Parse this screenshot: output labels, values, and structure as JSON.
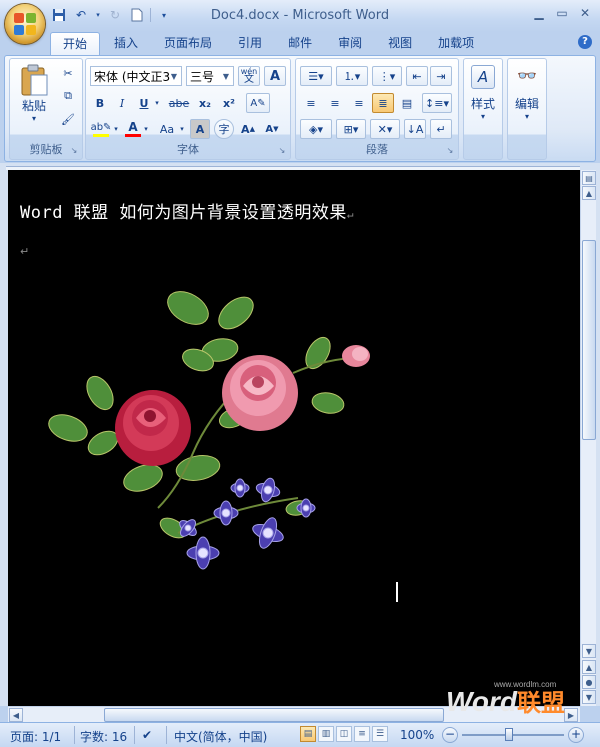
{
  "window": {
    "title": "Doc4.docx - Microsoft Word"
  },
  "ribbon_tabs": [
    "开始",
    "插入",
    "页面布局",
    "引用",
    "邮件",
    "审阅",
    "视图",
    "加载项"
  ],
  "ribbon": {
    "clipboard": {
      "label": "剪贴板",
      "paste": "粘贴"
    },
    "font": {
      "label": "字体",
      "font_name": "宋体 (中文正3",
      "font_size": "三号",
      "bold": "B",
      "italic": "I",
      "underline": "U",
      "strike": "abe",
      "subscript": "x₂",
      "superscript": "x²",
      "change_case": "Aa",
      "char_border": "A",
      "grow": "A",
      "shrink": "A",
      "wen": "wén"
    },
    "paragraph": {
      "label": "段落"
    },
    "styles": {
      "label": "样式"
    },
    "editing": {
      "label": "编辑"
    }
  },
  "document": {
    "heading": "Word 联盟 如何为图片背景设置透明效果",
    "para_mark": "↵"
  },
  "status": {
    "page": "页面: 1/1",
    "words": "字数: 16",
    "language": "中文(简体，中国)",
    "zoom": "100%"
  },
  "watermark": {
    "brand_en": "Word",
    "brand_cn": "联盟",
    "url": "www.wordlm.com"
  },
  "colors": {
    "highlight": "#ffff00",
    "font_color": "#ff0000",
    "page_bg": "#000000"
  }
}
